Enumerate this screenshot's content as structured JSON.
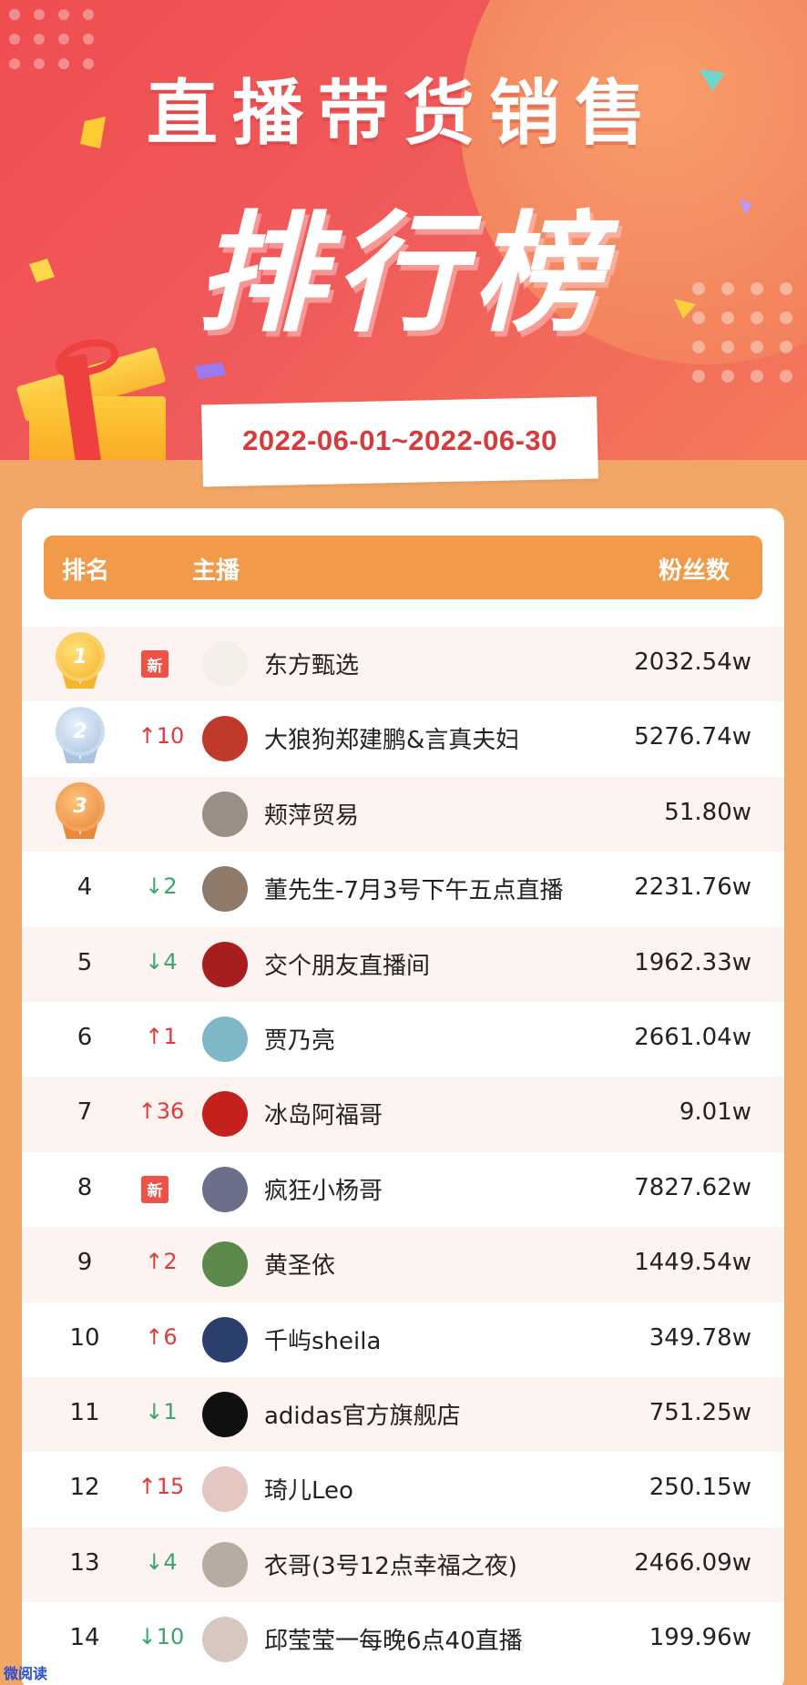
{
  "hero": {
    "title": "直播带货销售",
    "big_title": "排行榜",
    "date_range": "2022-06-01~2022-06-30"
  },
  "table": {
    "headers": {
      "rank": "排名",
      "anchor": "主播",
      "fans": "粉丝数"
    },
    "rows": [
      {
        "rank": "1",
        "medal": "gold",
        "change": "新",
        "change_type": "new",
        "name": "东方甄选",
        "fans": "2032.54w",
        "avatar_color": "#f4f0e8"
      },
      {
        "rank": "2",
        "medal": "silver",
        "change": "↑10",
        "change_type": "up",
        "name": "大狼狗郑建鹏&言真夫妇",
        "fans": "5276.74w",
        "avatar_color": "#c0392b"
      },
      {
        "rank": "3",
        "medal": "bronze",
        "change": "",
        "change_type": "none",
        "name": "颊萍贸易",
        "fans": "51.80w",
        "avatar_color": "#9a8f86"
      },
      {
        "rank": "4",
        "medal": "",
        "change": "↓2",
        "change_type": "down",
        "name": "董先生-7月3号下午五点直播",
        "fans": "2231.76w",
        "avatar_color": "#8f7a6a"
      },
      {
        "rank": "5",
        "medal": "",
        "change": "↓4",
        "change_type": "down",
        "name": "交个朋友直播间",
        "fans": "1962.33w",
        "avatar_color": "#a61e1e"
      },
      {
        "rank": "6",
        "medal": "",
        "change": "↑1",
        "change_type": "up",
        "name": "贾乃亮",
        "fans": "2661.04w",
        "avatar_color": "#7fb7c9"
      },
      {
        "rank": "7",
        "medal": "",
        "change": "↑36",
        "change_type": "up",
        "name": "冰岛阿福哥",
        "fans": "9.01w",
        "avatar_color": "#c4201e"
      },
      {
        "rank": "8",
        "medal": "",
        "change": "新",
        "change_type": "new",
        "name": "疯狂小杨哥",
        "fans": "7827.62w",
        "avatar_color": "#6b6f8a"
      },
      {
        "rank": "9",
        "medal": "",
        "change": "↑2",
        "change_type": "up",
        "name": "黄圣依",
        "fans": "1449.54w",
        "avatar_color": "#5b8a4a"
      },
      {
        "rank": "10",
        "medal": "",
        "change": "↑6",
        "change_type": "up",
        "name": "千屿sheila",
        "fans": "349.78w",
        "avatar_color": "#2b3f6c"
      },
      {
        "rank": "11",
        "medal": "",
        "change": "↓1",
        "change_type": "down",
        "name": "adidas官方旗舰店",
        "fans": "751.25w",
        "avatar_color": "#111111"
      },
      {
        "rank": "12",
        "medal": "",
        "change": "↑15",
        "change_type": "up",
        "name": "琦儿Leo",
        "fans": "250.15w",
        "avatar_color": "#e3c7c0"
      },
      {
        "rank": "13",
        "medal": "",
        "change": "↓4",
        "change_type": "down",
        "name": "衣哥(3号12点幸福之夜)",
        "fans": "2466.09w",
        "avatar_color": "#b8aca2"
      },
      {
        "rank": "14",
        "medal": "",
        "change": "↓10",
        "change_type": "down",
        "name": "邱莹莹一每晚6点40直播",
        "fans": "199.96w",
        "avatar_color": "#d8c7bf"
      }
    ]
  },
  "watermark": "微阅读"
}
